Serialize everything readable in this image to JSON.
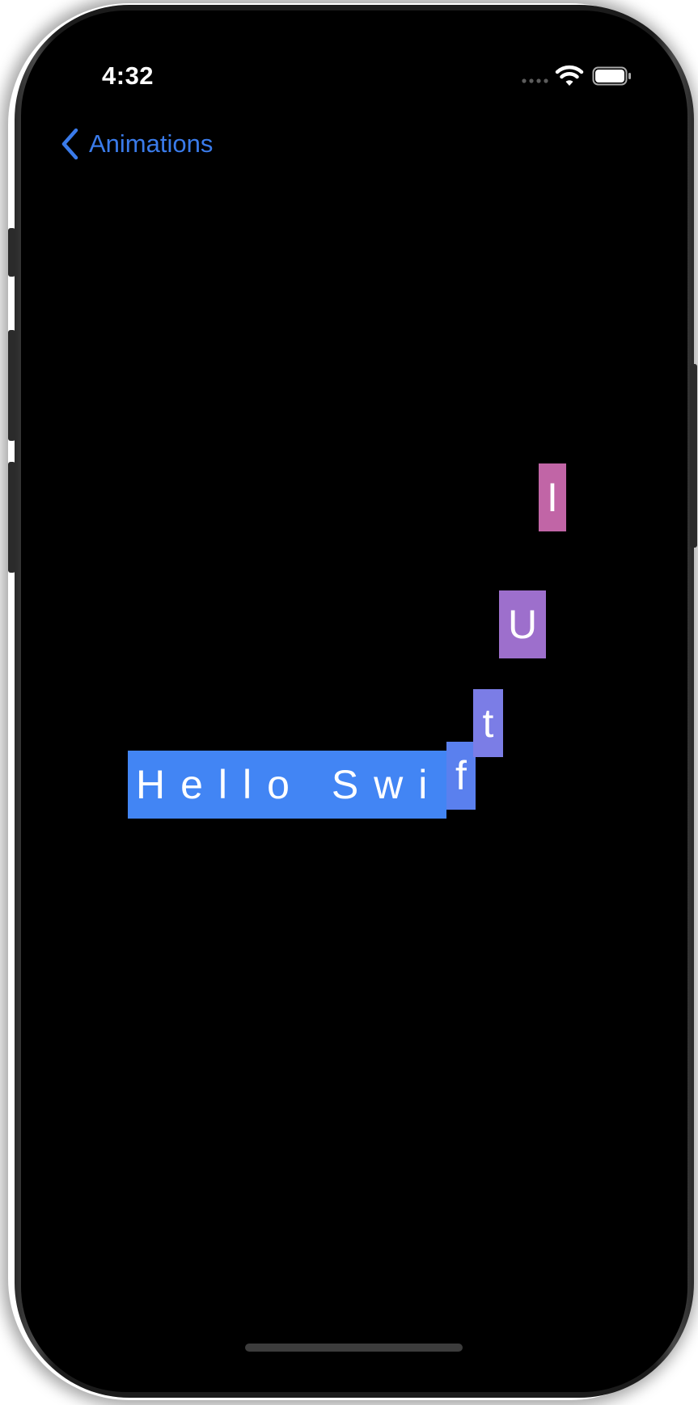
{
  "status_bar": {
    "time": "4:32"
  },
  "nav": {
    "back_label": "Animations",
    "back_icon": "chevron-left-icon"
  },
  "animation": {
    "main_text": "Hello Swi",
    "letters": [
      "f",
      "t",
      "U",
      "I"
    ],
    "colors": {
      "main": "#4285f4",
      "f": "#5a80ee",
      "t": "#7b7de6",
      "U": "#9d6fcc",
      "I": "#c165a6"
    }
  },
  "colors": {
    "accent": "#3a7bea",
    "background": "#000000"
  }
}
